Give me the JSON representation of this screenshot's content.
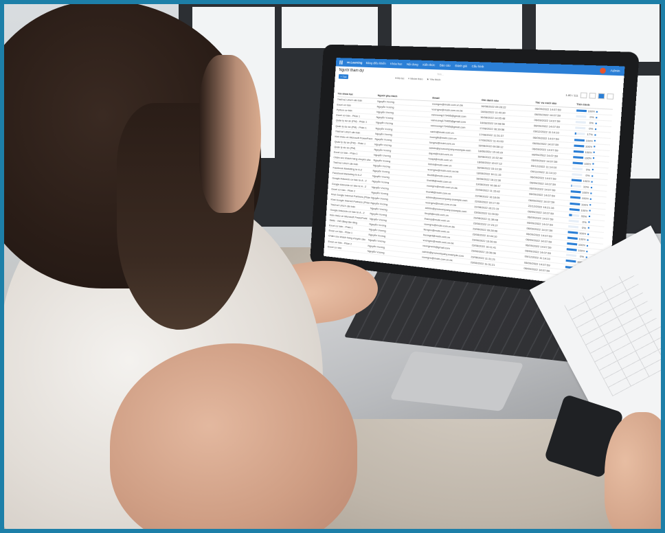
{
  "app": {
    "logo": "vn.Learning",
    "nav": [
      "Bảng điều khiển",
      "Khóa học",
      "Nội dung",
      "Kiến thức",
      "Báo cáo",
      "Đánh giá",
      "Cấu hình"
    ],
    "page_title": "Người tham dự",
    "add_button": "+ Tạo",
    "toolbar": [
      "▾ Bộ lọc",
      "≡ Nhóm theo",
      "★ Yêu thích"
    ],
    "search_placeholder": "Tìm...",
    "pager_text": "1-80 / 111",
    "user_badge": "Admin"
  },
  "table": {
    "columns": [
      "Tên khóa học",
      "Người phụ trách",
      "Email",
      "Ghi danh vào",
      "Tác vụ cuối vào",
      "Tiến trình"
    ],
    "rows": [
      {
        "course": "Thiết kế UI/UX căn bản",
        "owner": "Nguyễn Vương",
        "email": "vuongnv@mobi.com.vn.bk",
        "enrolled": "16/08/2022 09:28:22",
        "last": "06/09/2022 14:07:59",
        "progress": 100
      },
      {
        "course": "Excel cơ bản",
        "owner": "Nguyễn Vương",
        "email": "vuongnv@mobi.com.vn.bk",
        "enrolled": "16/08/2022 11:40:30",
        "last": "06/09/2022 14:07:59",
        "progress": 0
      },
      {
        "course": "Python cơ bản",
        "owner": "Nguyễn Vương",
        "email": "vanvuong179495@gmail.com",
        "enrolled": "16/08/2022 14:05:48",
        "last": "06/09/2022 14:07:59",
        "progress": 0
      },
      {
        "course": "Excel cơ bản - Phần 1",
        "owner": "Nguyễn Vương",
        "email": "vanvuong179495@gmail.com",
        "enrolled": "16/08/2022 14:08:56",
        "last": "06/09/2022 14:07:59",
        "progress": 0
      },
      {
        "course": "Quản lý dự án (PM) - Phần 1",
        "owner": "Nguyễn Vương",
        "email": "vanvuong179495@gmail.com",
        "enrolled": "17/08/2022 06:39:56",
        "last": "09/12/2022 11:14:10",
        "progress": 17
      },
      {
        "course": "Quản lý dự án (PM) - Phần 1",
        "owner": "Nguyễn Vương",
        "email": "vanhl@mobi.com.vn",
        "enrolled": "17/08/2022 11:51:37",
        "last": "06/09/2022 14:07:59",
        "progress": 100
      },
      {
        "course": "Thiết kế UI/UX căn bản",
        "owner": "Nguyễn Vương",
        "email": "buonglb@mobi.com.vn",
        "enrolled": "17/08/2022 11:41:53",
        "last": "06/09/2022 14:07:59",
        "progress": 100
      },
      {
        "course": "Kinh thiếu về Microsoft PowerPoint",
        "owner": "Nguyễn Vương",
        "email": "tungnv@mobi.com.vn",
        "enrolled": "18/08/2022 09:58:12",
        "last": "06/09/2022 14:07:59",
        "progress": 100
      },
      {
        "course": "Quản lý dự án (PM) - Phần 1",
        "owner": "Nguyễn Vương",
        "email": "admin@yourcompany.example.com",
        "enrolled": "18/08/2022 10:16:29",
        "last": "06/09/2022 14:07:59",
        "progress": 100
      },
      {
        "course": "Quản lý dự án (PM)",
        "owner": "Nguyễn Vương",
        "email": "dapnt@mobi.com.vn",
        "enrolled": "18/08/2022 10:32:44",
        "last": "06/09/2022 14:07:59",
        "progress": 100
      },
      {
        "course": "Excel cơ bản - Phần 1",
        "owner": "Nguyễn Vương",
        "email": "hoapt@mobi.com.vn",
        "enrolled": "18/08/2022 15:07:12",
        "last": "09/12/2022 11:14:10",
        "progress": 0
      },
      {
        "course": "Chăm sóc khách hàng chuyên sâu",
        "owner": "Nguyễn Vương",
        "email": "linhnt@mobi.com.vn",
        "enrolled": "18/08/2022 15:10:39",
        "last": "09/12/2022 11:14:10",
        "progress": 0
      },
      {
        "course": "Thiết kế UI/UX căn bản",
        "owner": "Nguyễn Vương",
        "email": "vuongnv@mobi.com.vn.bk",
        "enrolled": "18/08/2022 16:11:15",
        "last": "06/09/2022 14:07:59",
        "progress": 100
      },
      {
        "course": "Facebook Marketing từ A-Z",
        "owner": "Nguyễn Vương",
        "email": "thuhttt@mobi.com.vn",
        "enrolled": "18/08/2022 16:22:30",
        "last": "06/09/2022 14:07:59",
        "progress": 10
      },
      {
        "course": "Facebook Marketing từ A-Z",
        "owner": "Nguyễn Vương",
        "email": "thuhttt@mobi.com.vn",
        "enrolled": "19/08/2022 16:38:47",
        "last": "06/09/2022 14:07:59",
        "progress": 100
      },
      {
        "course": "Google Adwords cơ bản từ A - Z",
        "owner": "Nguyễn Vương",
        "email": "vuongnv@mobi.com.vn.bk",
        "enrolled": "22/08/2022 11:15:42",
        "last": "06/09/2022 14:07:59",
        "progress": 100
      },
      {
        "course": "Google Adwords cơ bản từ A - Z",
        "owner": "Nguyễn Vương",
        "email": "thuhttt@mobi.com.vn",
        "enrolled": "22/08/2022 16:18:09",
        "last": "06/09/2022 14:07:59",
        "progress": 100
      },
      {
        "course": "Excel cơ bản - Phần 2",
        "owner": "Nguyễn Vương",
        "email": "admin@yourcompany.example.com",
        "enrolled": "22/08/2022 16:17:39",
        "last": "22/12/2022 16:21:16",
        "progress": 100
      },
      {
        "course": "Khai Google Internet Partners (Phần 1: Cơ bản)",
        "owner": "Nguyễn Vương",
        "email": "vuongnv@mobi.com.vn.bk",
        "enrolled": "22/08/2022 16:21:19",
        "last": "06/09/2022 14:07:59",
        "progress": 33
      },
      {
        "course": "Khai Google Internet Partners (Phần 2: Hướng dẫn)",
        "owner": "Nguyễn Vương",
        "email": "admin@yourcompany.example.com",
        "enrolled": "23/08/2022 11:00:59",
        "last": "06/09/2022 14:07:59",
        "progress": 0
      },
      {
        "course": "Thiết kế UI/UX căn bản",
        "owner": "Nguyễn Vương",
        "email": "thuytt@mobi.com.vn",
        "enrolled": "23/08/2022 11:38:48",
        "last": "06/09/2022 14:07:59",
        "progress": 0
      },
      {
        "course": "Google Adwords cơ bản từ A - Z",
        "owner": "Nguyễn Vương",
        "email": "thaovp@mobi.com.vn",
        "enrolled": "23/08/2022 17:23:27",
        "last": "06/09/2022 14:07:59",
        "progress": 100
      },
      {
        "course": "Kiến thiếu về Microsoft PowerPoint",
        "owner": "Nguyễn Vương",
        "email": "vuongnv@mobi.com.vn.bk",
        "enrolled": "23/08/2022 09:28:06",
        "last": "06/09/2022 14:07:59",
        "progress": 100
      },
      {
        "course": "Skills - Viết đăng tâm lãng",
        "owner": "Nguyễn Vương",
        "email": "tiengnv@mobi.com.vn",
        "enrolled": "23/08/2022 10:44:10",
        "last": "06/09/2022 14:07:59",
        "progress": 100
      },
      {
        "course": "Excel cơ bản - Phần 1",
        "owner": "Nguyễn Vương",
        "email": "buongnt@mobi.com.vn",
        "enrolled": "23/08/2022 16:30:00",
        "last": "06/09/2022 14:07:59",
        "progress": 100
      },
      {
        "course": "Excel cơ bản - Phần 1",
        "owner": "Nguyễn Vương",
        "email": "vuongnv@mobi.com.vn.bk",
        "enrolled": "23/08/2022 16:11:41",
        "last": "06/09/2022 14:07:59",
        "progress": 0
      },
      {
        "course": "Chăm sóc khách hàng chuyên sâu",
        "owner": "Nguyễn Vương",
        "email": "vuongnvmt@gmail.com",
        "enrolled": "23/08/2022 16:36:06",
        "last": "09/12/2022 11:14:10",
        "progress": 100
      },
      {
        "course": "Excel cơ bản - Phần 2",
        "owner": "Nguyễn Vương",
        "email": "admin@yourcompany.example.com",
        "enrolled": "23/08/2022 11:31:21",
        "last": "06/09/2022 14:07:59",
        "progress": 100
      },
      {
        "course": "Excel cơ bản",
        "owner": "Nguyễn Vương",
        "email": "vuongnv@mobi.com.vn.bk",
        "enrolled": "23/08/2022 11:31:21",
        "last": "06/09/2022 14:07:59",
        "progress": 0
      }
    ]
  },
  "colors": {
    "brand_blue": "#2b7fd6",
    "border_teal": "#1d7fa8",
    "accent_yellow": "#f6c63a"
  }
}
